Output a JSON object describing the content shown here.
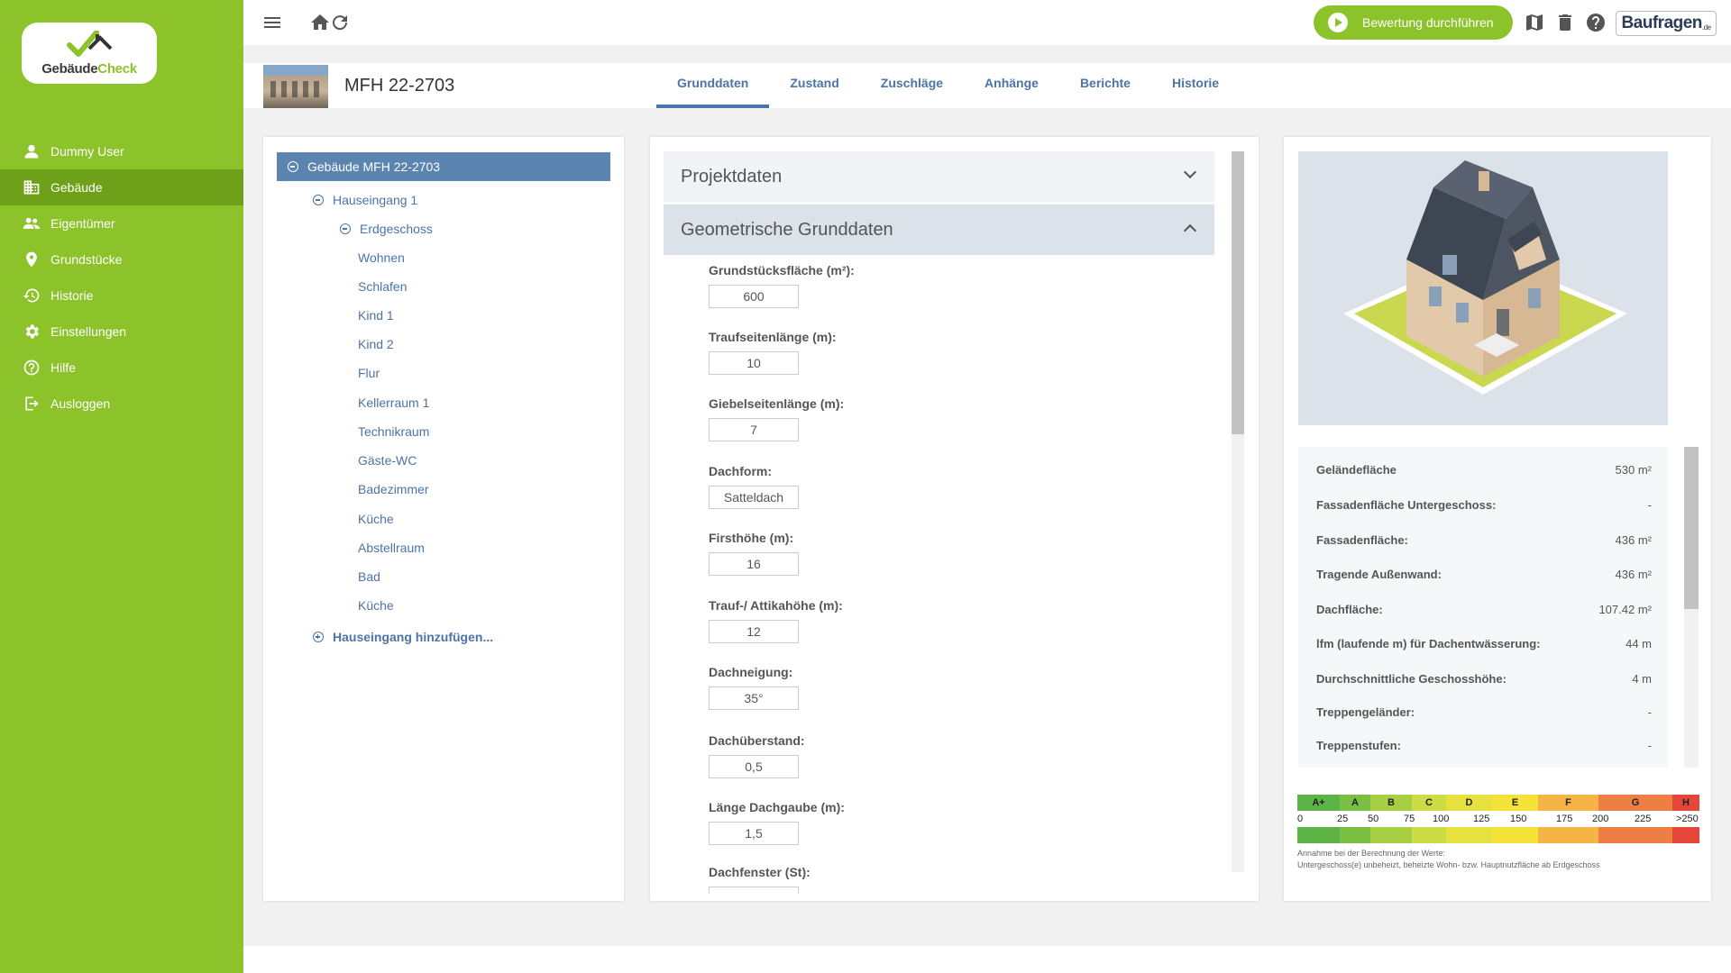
{
  "logo": {
    "name_part1": "Gebäude",
    "name_part2": "Check"
  },
  "nav": [
    {
      "label": "Dummy User",
      "icon": "user-icon"
    },
    {
      "label": "Gebäude",
      "icon": "building-icon",
      "active": true
    },
    {
      "label": "Eigentümer",
      "icon": "owners-icon"
    },
    {
      "label": "Grundstücke",
      "icon": "location-pin-icon"
    },
    {
      "label": "Historie",
      "icon": "history-icon"
    },
    {
      "label": "Einstellungen",
      "icon": "gear-icon"
    },
    {
      "label": "Hilfe",
      "icon": "help-icon"
    },
    {
      "label": "Ausloggen",
      "icon": "logout-icon"
    }
  ],
  "topbar": {
    "eval_button": "Bewertung durchführen",
    "partner_logo": "Baufragen",
    "partner_logo_suffix": ".de"
  },
  "header": {
    "title": "MFH 22-2703",
    "tabs": [
      "Grunddaten",
      "Zustand",
      "Zuschläge",
      "Anhänge",
      "Berichte",
      "Historie"
    ],
    "active_tab": "Grunddaten"
  },
  "tree": {
    "root": "Gebäude MFH 22-2703",
    "entrance": "Hauseingang 1",
    "floor": "Erdgeschoss",
    "rooms": [
      "Wohnen",
      "Schlafen",
      "Kind 1",
      "Kind 2",
      "Flur",
      "Kellerraum 1",
      "Technikraum",
      "Gäste-WC",
      "Badezimmer",
      "Küche",
      "Abstellraum",
      "Bad",
      "Küche"
    ],
    "add_entrance": "Hauseingang hinzufügen..."
  },
  "form": {
    "section1": "Projektdaten",
    "section2": "Geometrische Grunddaten",
    "fields": [
      {
        "label": "Grundstücksfläche (m²):",
        "value": "600"
      },
      {
        "label": "Traufseitenlänge (m):",
        "value": "10"
      },
      {
        "label": "Giebelseitenlänge (m):",
        "value": "7"
      },
      {
        "label": "Dachform:",
        "value": "Satteldach"
      },
      {
        "label": "Firsthöhe (m):",
        "value": "16"
      },
      {
        "label": "Trauf-/ Attikahöhe (m):",
        "value": "12"
      },
      {
        "label": "Dachneigung:",
        "value": "35°"
      },
      {
        "label": "Dachüberstand:",
        "value": "0,5"
      },
      {
        "label": "Länge Dachgaube (m):",
        "value": "1,5"
      },
      {
        "label": "Dachfenster (St):",
        "value": ""
      }
    ]
  },
  "info": {
    "rows": [
      {
        "k": "Geländefläche",
        "v": "530 m²"
      },
      {
        "k": "Fassadenfläche Untergeschoss:",
        "v": "-"
      },
      {
        "k": "Fassadenfläche:",
        "v": "436 m²"
      },
      {
        "k": "Tragende Außenwand:",
        "v": "436 m²"
      },
      {
        "k": "Dachfläche:",
        "v": "107.42 m²"
      },
      {
        "k": "lfm (laufende m) für Dachentwässerung:",
        "v": "44 m"
      },
      {
        "k": "Durchschnittliche Geschosshöhe:",
        "v": "4 m"
      },
      {
        "k": "Treppengeländer:",
        "v": "-"
      },
      {
        "k": "Treppenstufen:",
        "v": "-"
      }
    ]
  },
  "scale": {
    "grades": [
      {
        "label": "A+",
        "color": "#5bb445"
      },
      {
        "label": "A",
        "color": "#7abf43"
      },
      {
        "label": "B",
        "color": "#a7cf43"
      },
      {
        "label": "C",
        "color": "#cddc45"
      },
      {
        "label": "D",
        "color": "#e6e13f"
      },
      {
        "label": "E",
        "color": "#f6e33a"
      },
      {
        "label": "F",
        "color": "#f6b447"
      },
      {
        "label": "G",
        "color": "#ed7f45"
      },
      {
        "label": "H",
        "color": "#e4473a"
      }
    ],
    "numbers": [
      "0",
      "25",
      "50",
      "75",
      "100",
      "125",
      "150",
      "175",
      "200",
      "225",
      ">250"
    ],
    "note_line1": "Annahme bei der Berechnung der Werte:",
    "note_line2": "Untergeschoss(e) unbeheizt, beheizte Wohn- bzw. Hauptnutzfläche ab Erdgeschoss"
  }
}
